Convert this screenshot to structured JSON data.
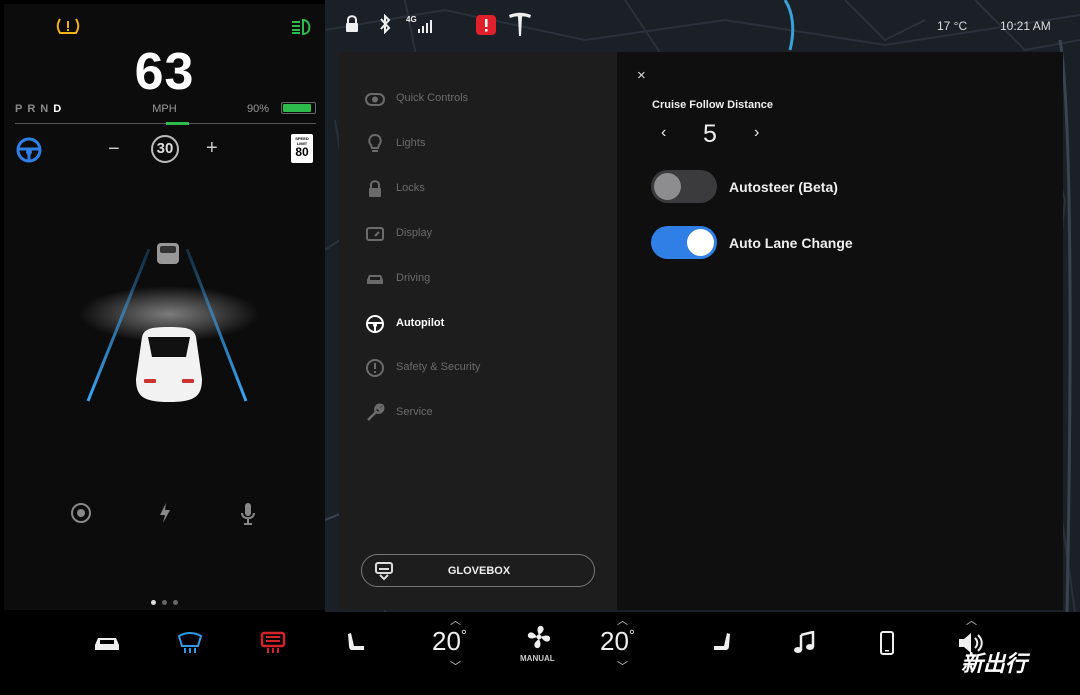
{
  "cluster": {
    "speed": "63",
    "gears": [
      "P",
      "R",
      "N",
      "D"
    ],
    "active_gear": "D",
    "speed_unit": "MPH",
    "battery_percent_label": "90%",
    "battery_level": 0.9,
    "cruise_minus": "−",
    "cruise_set_speed": "30",
    "cruise_plus": "+",
    "speed_limit_sign_text": "SPEED LIMIT",
    "speed_limit": "80",
    "icons": [
      "tire-pressure-warning-icon",
      "headlights-icon",
      "steering-wheel-icon",
      "camera-icon",
      "charging-bolt-icon",
      "microphone-icon"
    ],
    "page_dots": 3,
    "active_dot": 0
  },
  "status_bar": {
    "network": "4G",
    "outside_temp": "17 °C",
    "time": "10:21 AM",
    "icons": [
      "lock-icon",
      "bluetooth-icon",
      "signal-icon",
      "alert-icon",
      "tesla-logo-icon"
    ]
  },
  "settings_menu": {
    "items": [
      {
        "label": "Quick Controls",
        "icon": "quick-controls-icon"
      },
      {
        "label": "Lights",
        "icon": "lightbulb-icon"
      },
      {
        "label": "Locks",
        "icon": "lock-icon"
      },
      {
        "label": "Display",
        "icon": "display-icon"
      },
      {
        "label": "Driving",
        "icon": "car-icon"
      },
      {
        "label": "Autopilot",
        "icon": "steering-wheel-icon",
        "active": true
      },
      {
        "label": "Safety & Security",
        "icon": "alert-circle-icon"
      },
      {
        "label": "Service",
        "icon": "wrench-icon"
      }
    ],
    "glovebox_label": "GLOVEBOX"
  },
  "autopilot": {
    "close": "×",
    "cruise_follow_distance_label": "Cruise Follow Distance",
    "cruise_follow_distance_value": "5",
    "prev": "‹",
    "next": "›",
    "toggles": [
      {
        "label": "Autosteer (Beta)",
        "on": false
      },
      {
        "label": "Auto Lane Change",
        "on": true
      }
    ]
  },
  "bottom_bar": {
    "driver_temp": "20",
    "passenger_temp": "20",
    "degree": "°",
    "fan_mode": "MANUAL",
    "icons": [
      "car-icon",
      "front-defrost-icon",
      "rear-defrost-icon",
      "driver-seat-heater-icon",
      "fan-icon",
      "passenger-seat-heater-icon",
      "music-note-icon",
      "phone-icon",
      "volume-icon"
    ]
  },
  "watermark": "新出行",
  "colors": {
    "accent_blue": "#2f7fe6",
    "battery_green": "#2dbb4b",
    "alert_red": "#e0202a",
    "warning_yellow": "#f2b21b",
    "rear_defrost_red": "#d3232a"
  }
}
